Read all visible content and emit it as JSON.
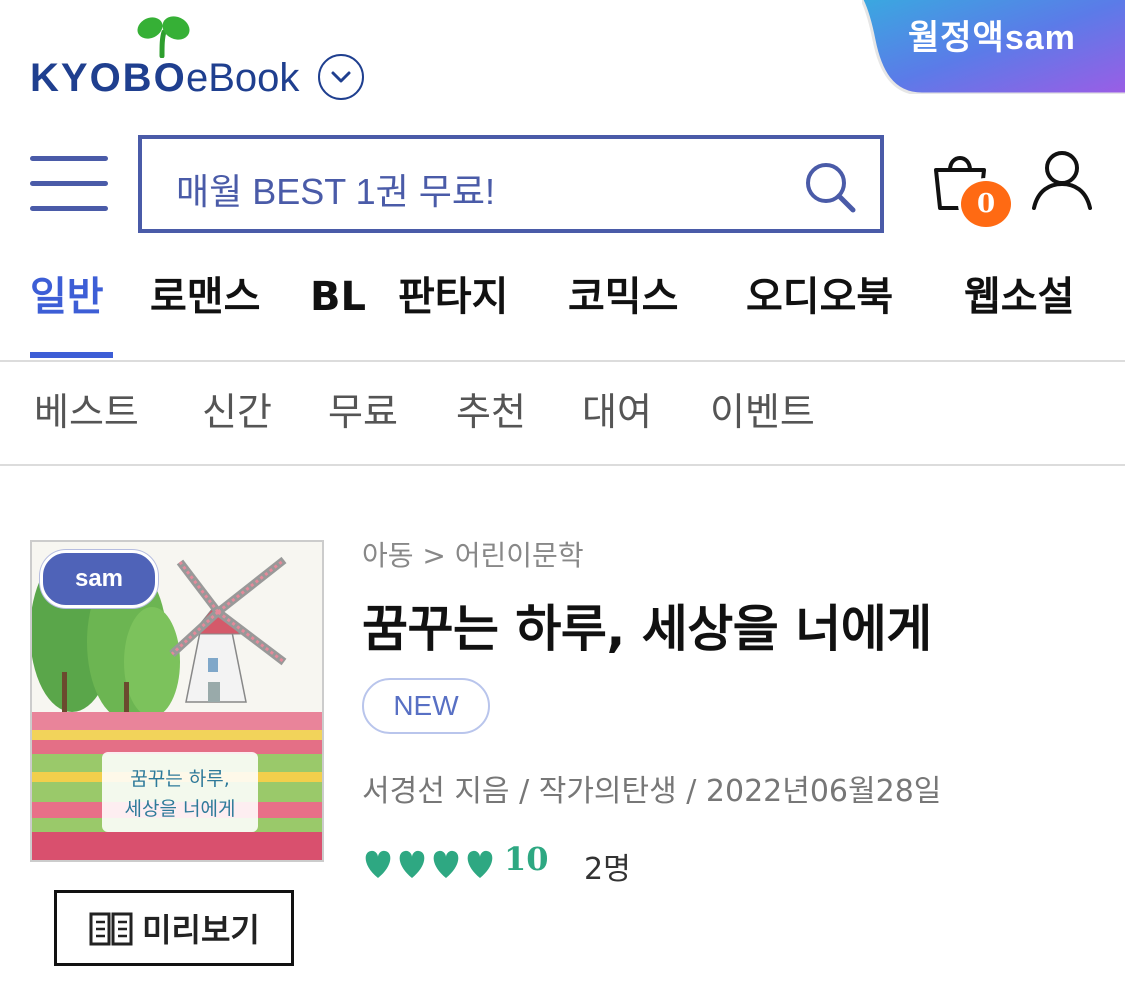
{
  "header": {
    "logo_brand": "KYOBO",
    "logo_product": "eBook",
    "promo_label": "월정액sam",
    "colors": {
      "brand": "#1f3f8f",
      "accent": "#3d5ed6",
      "badge": "#ff6a13",
      "rating": "#2ea882"
    }
  },
  "search": {
    "placeholder": "매월 BEST 1권 무료!"
  },
  "cart": {
    "count": "0"
  },
  "icons": [
    "menu-icon",
    "search-icon",
    "cart-icon",
    "user-icon",
    "chevron-down-icon",
    "book-open-icon",
    "heart-icon"
  ],
  "category_tabs": [
    {
      "label": "일반",
      "active": true
    },
    {
      "label": "로맨스",
      "active": false
    },
    {
      "label": "BL",
      "active": false
    },
    {
      "label": "판타지",
      "active": false
    },
    {
      "label": "코믹스",
      "active": false
    },
    {
      "label": "오디오북",
      "active": false
    },
    {
      "label": "웹소설",
      "active": false
    }
  ],
  "sub_tabs": [
    {
      "label": "베스트"
    },
    {
      "label": "신간"
    },
    {
      "label": "무료"
    },
    {
      "label": "추천"
    },
    {
      "label": "대여"
    },
    {
      "label": "이벤트"
    }
  ],
  "book": {
    "breadcrumb": "아동 > 어린이문학",
    "title": "꿈꾸는 하루, 세상을 너에게",
    "badge": "NEW",
    "meta": "서경선 지음 /  작가의탄생 / 2022년06월28일",
    "rating": "10",
    "hearts": 4,
    "reviewers": "2명",
    "cover": {
      "badge": "sam",
      "title_line1": "꿈꾸는 하루,",
      "title_line2": "세상을 너에게"
    },
    "preview_label": "미리보기"
  }
}
